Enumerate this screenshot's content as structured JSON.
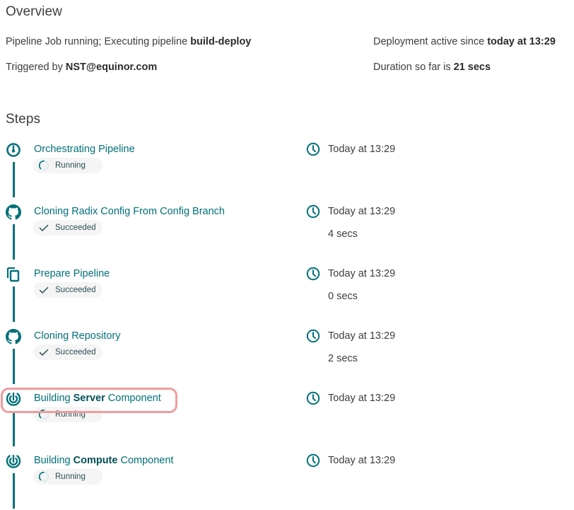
{
  "overview": {
    "title": "Overview",
    "status_prefix": "Pipeline Job running; Executing pipeline ",
    "pipeline_name": "build-deploy",
    "triggered_prefix": "Triggered by ",
    "triggered_by": "NST@equinor.com",
    "active_prefix": "Deployment active since ",
    "active_since": "today at 13:29",
    "duration_prefix": "Duration so far is ",
    "duration": "21 secs"
  },
  "steps_section": {
    "title": "Steps",
    "steps": [
      {
        "icon": "pipeline-orchestrate-icon",
        "title_pre": "Orchestrating Pipeline",
        "title_bold": "",
        "title_post": "",
        "status": "Running",
        "status_icon": "spinner-icon",
        "started": "Today at 13:29",
        "duration": ""
      },
      {
        "icon": "github-icon",
        "title_pre": "Cloning Radix Config From Config Branch",
        "title_bold": "",
        "title_post": "",
        "status": "Succeeded",
        "status_icon": "check-icon",
        "started": "Today at 13:29",
        "duration": "4 secs"
      },
      {
        "icon": "copy-icon",
        "title_pre": "Prepare Pipeline",
        "title_bold": "",
        "title_post": "",
        "status": "Succeeded",
        "status_icon": "check-icon",
        "started": "Today at 13:29",
        "duration": "0 secs"
      },
      {
        "icon": "github-icon",
        "title_pre": "Cloning Repository",
        "title_bold": "",
        "title_post": "",
        "status": "Succeeded",
        "status_icon": "check-icon",
        "started": "Today at 13:29",
        "duration": "2 secs"
      },
      {
        "icon": "build-target-icon",
        "title_pre": "Building ",
        "title_bold": "Server",
        "title_post": " Component",
        "status": "Running",
        "status_icon": "spinner-icon",
        "started": "Today at 13:29",
        "duration": ""
      },
      {
        "icon": "build-target-icon",
        "title_pre": "Building ",
        "title_bold": "Compute",
        "title_post": " Component",
        "status": "Running",
        "status_icon": "spinner-icon",
        "started": "Today at 13:29",
        "duration": ""
      }
    ]
  },
  "colors": {
    "accent": "#007079",
    "highlight": "#f09c9e",
    "chip_bg": "#f5f5f5"
  }
}
